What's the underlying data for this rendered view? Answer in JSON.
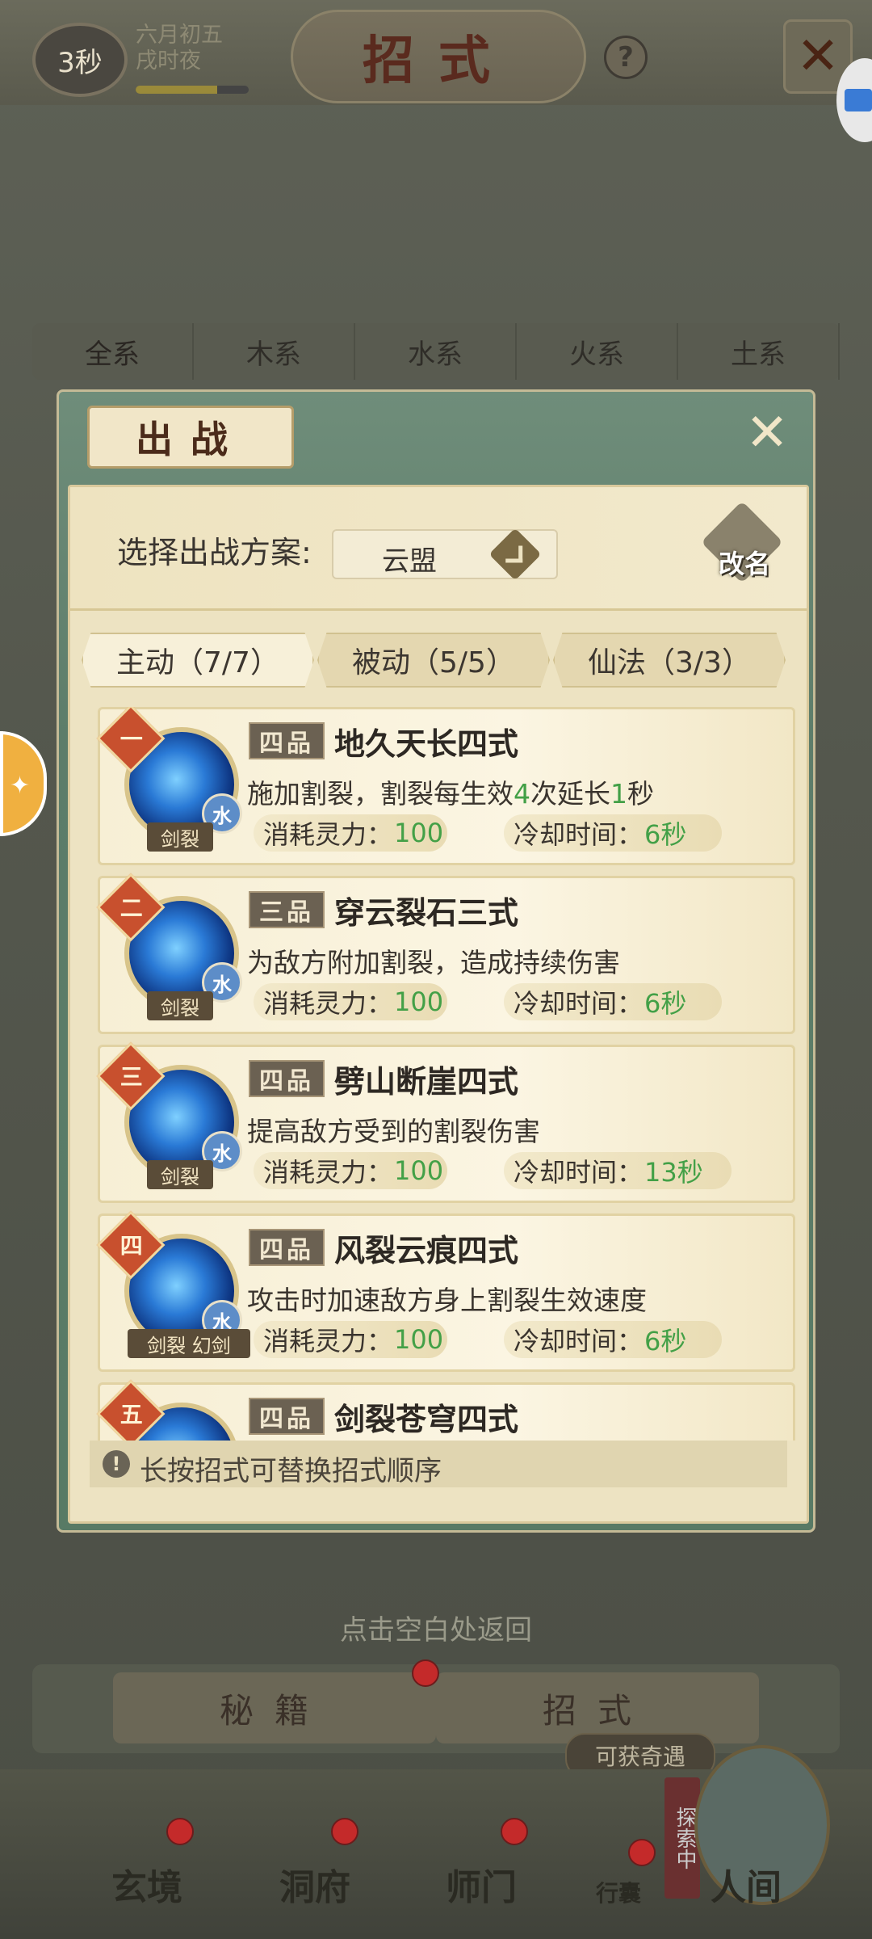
{
  "header": {
    "timer": "3秒",
    "date_line1": "六月初五",
    "date_line2": "戌时夜",
    "date_progress": 0.72,
    "title": "招式",
    "help_glyph": "?",
    "close_glyph": "✕"
  },
  "category_tabs": [
    "全系",
    "木系",
    "水系",
    "火系",
    "土系"
  ],
  "modal": {
    "title": "出战",
    "close_glyph": "✕",
    "plan_label": "选择出战方案:",
    "plan_value": "云盟",
    "rename_label": "改名",
    "tabs": [
      {
        "label": "主动（7/7）",
        "active": true
      },
      {
        "label": "被动（5/5）",
        "active": false
      },
      {
        "label": "仙法（3/3）",
        "active": false
      }
    ],
    "skills": [
      {
        "rank": "一",
        "grade": "四品",
        "name": "地久天长四式",
        "desc_parts": [
          "施加割裂，割裂每生效",
          "4",
          "次延长",
          "1",
          "秒"
        ],
        "element": "水",
        "tags": "剑裂",
        "cost_label": "消耗灵力：",
        "cost_value": "100",
        "cd_label": "冷却时间：",
        "cd_value": "6秒"
      },
      {
        "rank": "二",
        "grade": "三品",
        "name": "穿云裂石三式",
        "desc": "为敌方附加割裂，造成持续伤害",
        "element": "水",
        "tags": "剑裂",
        "cost_label": "消耗灵力：",
        "cost_value": "100",
        "cd_label": "冷却时间：",
        "cd_value": "6秒"
      },
      {
        "rank": "三",
        "grade": "四品",
        "name": "劈山断崖四式",
        "desc": "提高敌方受到的割裂伤害",
        "element": "水",
        "tags": "剑裂",
        "cost_label": "消耗灵力：",
        "cost_value": "100",
        "cd_label": "冷却时间：",
        "cd_value": "13秒"
      },
      {
        "rank": "四",
        "grade": "四品",
        "name": "风裂云痕四式",
        "desc": "攻击时加速敌方身上割裂生效速度",
        "element": "水",
        "tags": "剑裂 幻剑",
        "cost_label": "消耗灵力：",
        "cost_value": "100",
        "cd_label": "冷却时间：",
        "cd_value": "6秒"
      },
      {
        "rank": "五",
        "grade": "四品",
        "name": "剑裂苍穹四式"
      }
    ],
    "hint_icon": "!",
    "hint": "长按招式可替换招式顺序"
  },
  "return_hint": "点击空白处返回",
  "bottom_tabs": [
    "秘籍",
    "招式"
  ],
  "chance_label": "可获奇遇",
  "explore_tag": "探索中",
  "nav": [
    "玄境",
    "洞府",
    "师门",
    "行囊",
    "人间"
  ],
  "colors": {
    "accent_green": "#43a047",
    "rank_red": "#c8502e",
    "modal_green": "#5d7d6a",
    "parchment": "#ede3c2"
  }
}
